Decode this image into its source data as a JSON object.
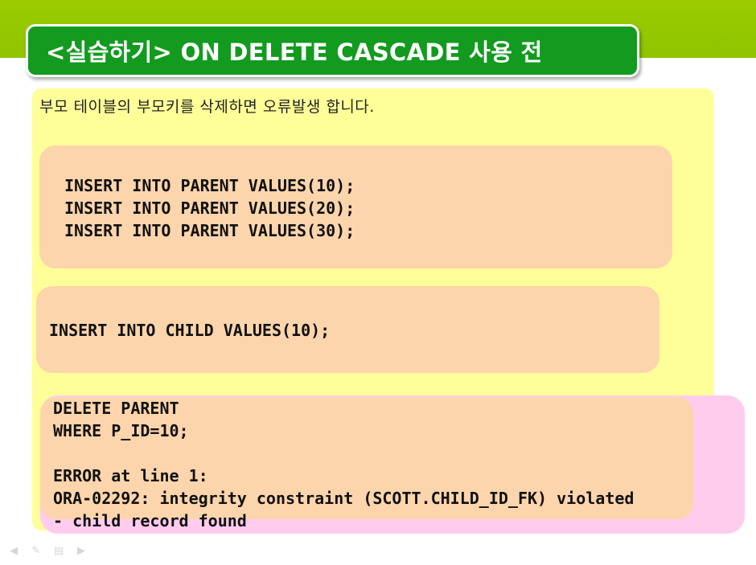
{
  "slide": {
    "title": "<실습하기> ON DELETE CASCADE 사용 전",
    "intro": "부모 테이블의 부모키를 삭제하면 오류발생 합니다.",
    "code_blocks": [
      {
        "text": "INSERT INTO PARENT VALUES(10);\nINSERT INTO PARENT VALUES(20);\nINSERT INTO PARENT VALUES(30);"
      },
      {
        "text": "INSERT INTO CHILD VALUES(10);"
      },
      {
        "text": "DELETE PARENT\nWHERE P_ID=10;\n\nERROR at line 1:\nORA-02292: integrity constraint (SCOTT.CHILD_ID_FK) violated\n- child record found"
      }
    ]
  },
  "colors": {
    "header_band": "#9ccc00",
    "title_bg": "#129b1f",
    "panel_yellow": "#ffff99",
    "code_box": "#fcd5ac",
    "highlight_pink": "#ffccee"
  },
  "nav_icons": [
    "arrow-left-icon",
    "pen-icon",
    "menu-icon",
    "arrow-right-icon"
  ]
}
